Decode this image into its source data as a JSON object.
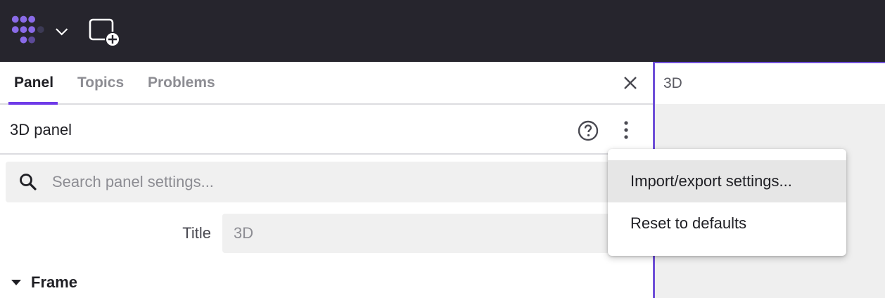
{
  "topbar": {
    "logo_icon": "app-logo-icon",
    "logo_menu_icon": "chevron-down-icon",
    "add_panel_icon": "add-panel-icon"
  },
  "sidebar": {
    "tabs": [
      {
        "label": "Panel",
        "active": true
      },
      {
        "label": "Topics",
        "active": false
      },
      {
        "label": "Problems",
        "active": false
      }
    ],
    "close_icon": "close-icon",
    "panel_title": "3D panel",
    "help_icon": "help-circle-icon",
    "more_icon": "more-vertical-icon",
    "search": {
      "placeholder": "Search panel settings...",
      "value": ""
    },
    "fields": {
      "title_label": "Title",
      "title_value": "3D"
    },
    "section": {
      "label": "Frame",
      "expanded": true
    }
  },
  "panel": {
    "title": "3D"
  },
  "context_menu": {
    "items": [
      {
        "label": "Import/export settings..."
      },
      {
        "label": "Reset to defaults"
      }
    ]
  },
  "colors": {
    "accent": "#6f3be8",
    "topbar": "#26252d",
    "logo": "#8a6be8"
  }
}
